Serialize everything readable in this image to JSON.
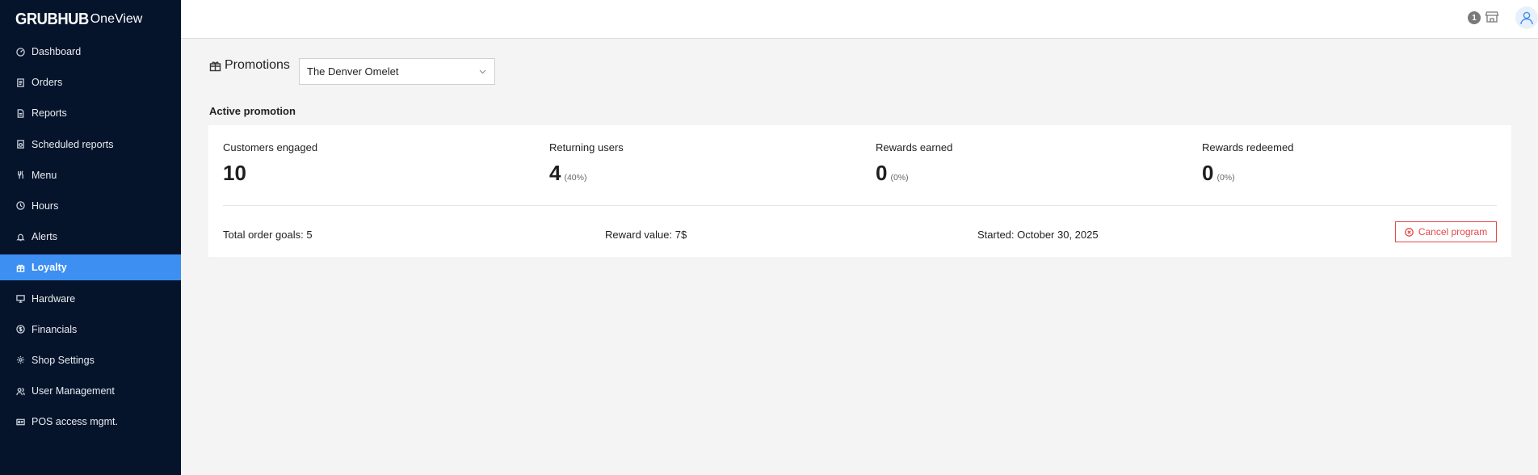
{
  "app": {
    "brand": "GRUBHUB",
    "product": "OneView"
  },
  "sidebar": {
    "items": [
      {
        "label": "Dashboard",
        "icon": "gauge-icon",
        "active": false
      },
      {
        "label": "Orders",
        "icon": "receipt-icon",
        "active": false
      },
      {
        "label": "Reports",
        "icon": "document-icon",
        "active": false
      },
      {
        "label": "Scheduled reports",
        "icon": "calendar-document-icon",
        "active": false
      },
      {
        "label": "Menu",
        "icon": "utensils-icon",
        "active": false
      },
      {
        "label": "Hours",
        "icon": "clock-icon",
        "active": false
      },
      {
        "label": "Alerts",
        "icon": "bell-icon",
        "active": false
      },
      {
        "label": "Loyalty",
        "icon": "gift-icon",
        "active": true
      },
      {
        "label": "Hardware",
        "icon": "monitor-icon",
        "active": false
      },
      {
        "label": "Financials",
        "icon": "dollar-circle-icon",
        "active": false
      },
      {
        "label": "Shop Settings",
        "icon": "gear-icon",
        "active": false
      },
      {
        "label": "User Management",
        "icon": "users-icon",
        "active": false
      },
      {
        "label": "POS access mgmt.",
        "icon": "id-card-icon",
        "active": false
      }
    ]
  },
  "topbar": {
    "notification_count": "1"
  },
  "page": {
    "title": "Promotions",
    "store_select": {
      "value": "The Denver Omelet"
    },
    "section_title": "Active promotion"
  },
  "promotion": {
    "stats": [
      {
        "label": "Customers engaged",
        "value": "10",
        "pct": ""
      },
      {
        "label": "Returning users",
        "value": "4",
        "pct": "(40%)"
      },
      {
        "label": "Rewards earned",
        "value": "0",
        "pct": "(0%)"
      },
      {
        "label": "Rewards redeemed",
        "value": "0",
        "pct": "(0%)"
      }
    ],
    "total_order_goals": "Total order goals: 5",
    "reward_value": "Reward value: 7$",
    "started": "Started: October 30, 2025",
    "cancel_label": "Cancel program"
  },
  "colors": {
    "sidebar_bg": "#06142b",
    "active_item": "#3d8ff2",
    "danger": "#e54848"
  }
}
